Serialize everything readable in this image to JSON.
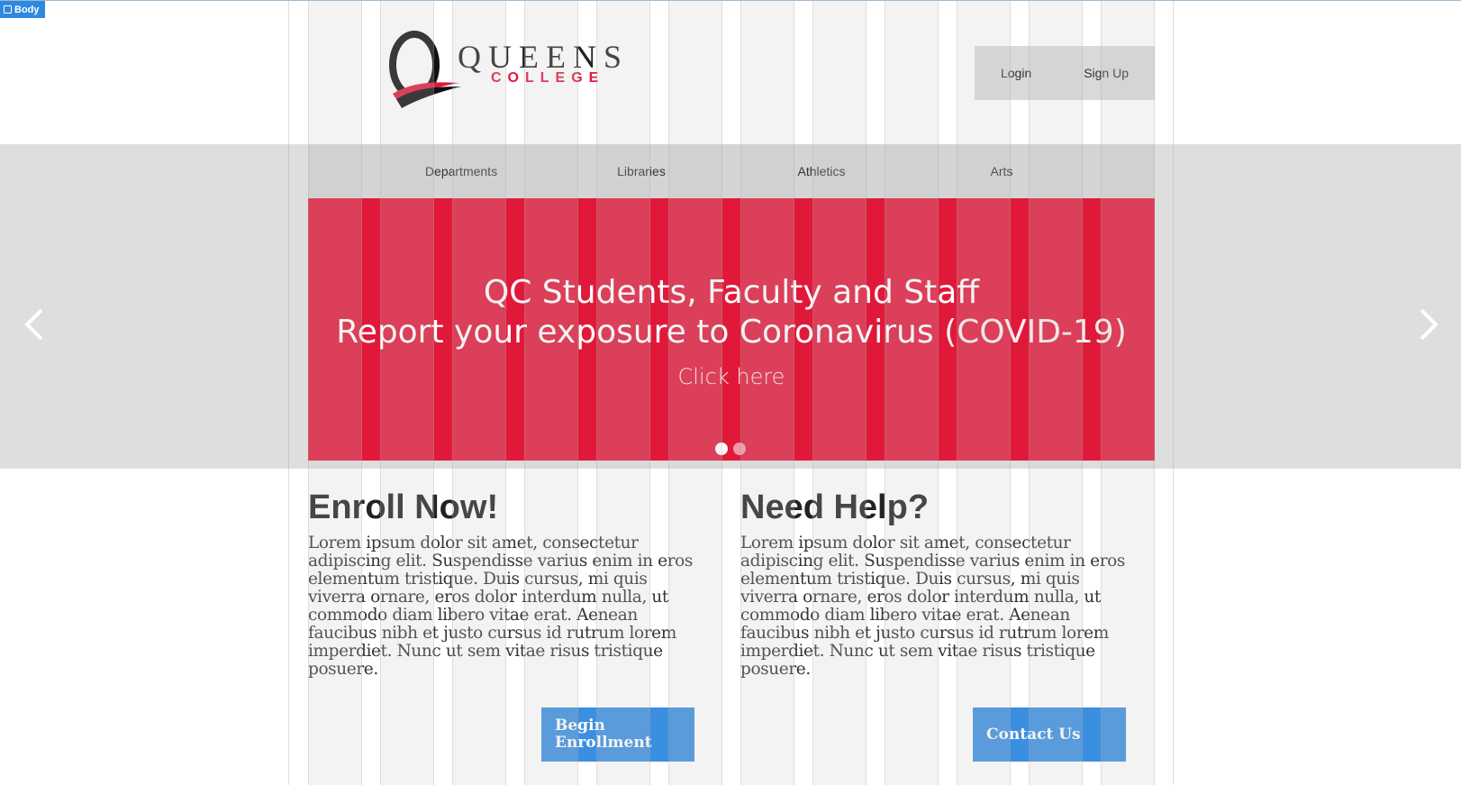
{
  "editor": {
    "badge_label": "Body"
  },
  "header": {
    "logo_letter": "Q",
    "logo_queens": "QUEENS",
    "logo_college": "COLLEGE",
    "login_label": "Login",
    "signup_label": "Sign Up"
  },
  "nav": {
    "items": [
      {
        "label": "Departments"
      },
      {
        "label": "Libraries"
      },
      {
        "label": "Athletics"
      },
      {
        "label": "Arts"
      }
    ]
  },
  "slider": {
    "line1": "QC Students, Faculty and Staff",
    "line2_main": "Report your exposure to Coronavirus ",
    "line2_paren": "(COVID-19)",
    "line3": "Click here",
    "prev_icon": "chevron-left-icon",
    "next_icon": "chevron-right-icon",
    "slide_count": 2,
    "active_slide": 1,
    "background_color": "#e0193a"
  },
  "sections": [
    {
      "heading": "Enroll Now!",
      "body": "Lorem ipsum dolor sit amet, consectetur adipiscing elit. Suspendisse varius enim in eros elementum tristique. Duis cursus, mi quis viverra ornare, eros dolor interdum nulla, ut commodo diam libero vitae erat. Aenean faucibus nibh et justo cursus id rutrum lorem imperdiet. Nunc ut sem vitae risus tristique posuere.",
      "button_label": "Begin Enrollment"
    },
    {
      "heading": "Need Help?",
      "body": "Lorem ipsum dolor sit amet, consectetur adipiscing elit. Suspendisse varius enim in eros elementum tristique. Duis cursus, mi quis viverra ornare, eros dolor interdum nulla, ut commodo diam libero vitae erat. Aenean faucibus nibh et justo cursus id rutrum lorem imperdiet. Nunc ut sem vitae risus tristique posuere.",
      "button_label": "Contact Us"
    }
  ],
  "colors": {
    "brand_red": "#e0193a",
    "button_blue": "#3b8fe0",
    "nav_gray": "#d4d4d4"
  }
}
